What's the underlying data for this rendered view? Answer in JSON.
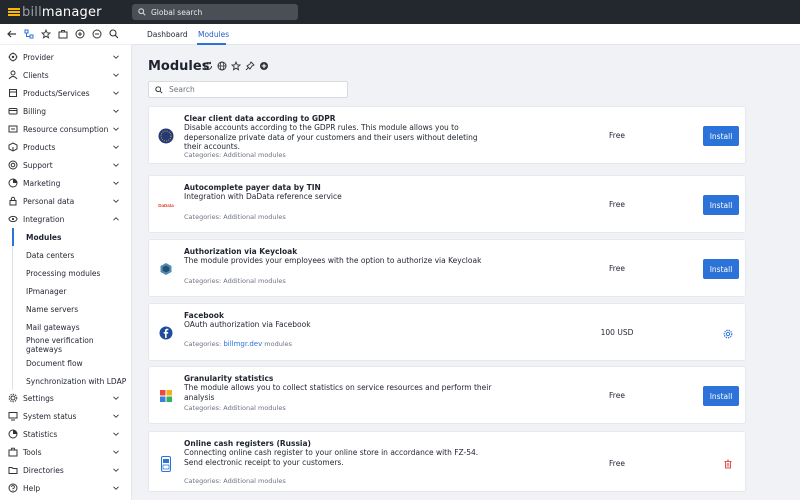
{
  "app": {
    "logo_prefix": "bill",
    "logo_suffix": "manager",
    "global_search_placeholder": "Global search"
  },
  "tabs": [
    {
      "label": "Dashboard"
    },
    {
      "label": "Modules",
      "active": true
    }
  ],
  "sidebar": {
    "items": [
      {
        "label": "Provider",
        "icon": "provider-icon"
      },
      {
        "label": "Clients",
        "icon": "clients-icon"
      },
      {
        "label": "Products/Services",
        "icon": "products-services-icon"
      },
      {
        "label": "Billing",
        "icon": "billing-icon"
      },
      {
        "label": "Resource consumption",
        "icon": "resource-icon"
      },
      {
        "label": "Products",
        "icon": "products-icon"
      },
      {
        "label": "Support",
        "icon": "support-icon"
      },
      {
        "label": "Marketing",
        "icon": "marketing-icon"
      },
      {
        "label": "Personal data",
        "icon": "personal-data-icon"
      },
      {
        "label": "Integration",
        "icon": "integration-icon",
        "expanded": true
      }
    ],
    "integration_sub": [
      {
        "label": "Modules",
        "active": true
      },
      {
        "label": "Data centers"
      },
      {
        "label": "Processing modules"
      },
      {
        "label": "IPmanager"
      },
      {
        "label": "Name servers"
      },
      {
        "label": "Mail gateways"
      },
      {
        "label": "Phone verification gateways"
      },
      {
        "label": "Document flow"
      },
      {
        "label": "Synchronization with LDAP"
      }
    ],
    "items_after": [
      {
        "label": "Settings",
        "icon": "settings-icon"
      },
      {
        "label": "System status",
        "icon": "system-status-icon"
      },
      {
        "label": "Statistics",
        "icon": "statistics-icon"
      },
      {
        "label": "Tools",
        "icon": "tools-icon"
      },
      {
        "label": "Directories",
        "icon": "directories-icon"
      },
      {
        "label": "Help",
        "icon": "help-icon"
      }
    ]
  },
  "main": {
    "title": "Modules",
    "search_placeholder": "Search",
    "cards": [
      {
        "title": "Clear client data according to GDPR",
        "desc": "Disable accounts according to the GDPR rules. This module allows you to depersonalize private data of your customers and their users without deleting their accounts.",
        "category_prefix": "Categories: Additional modules",
        "price": "Free",
        "action": "Install",
        "icon": "gdpr-icon"
      },
      {
        "title": "Autocomplete payer data by TIN",
        "desc": "Integration with DaData reference service",
        "category_prefix": "Categories: Additional modules",
        "price": "Free",
        "action": "Install",
        "icon": "dadata-icon"
      },
      {
        "title": "Authorization via Keycloak",
        "desc": "The module provides your employees with the option to authorize via Keycloak",
        "category_prefix": "Categories: Additional modules",
        "price": "Free",
        "action": "Install",
        "icon": "keycloak-icon"
      },
      {
        "title": "Facebook",
        "desc": "OAuth authorization via Facebook",
        "category_prefix": "Categories:",
        "category_link": "billmgr.dev",
        "category_suffix": "modules",
        "price": "100 USD",
        "action_icon": "settings-gear-icon",
        "icon": "facebook-icon"
      },
      {
        "title": "Granularity statistics",
        "desc": "The module allows you to collect statistics on service resources and perform their analysis",
        "category_prefix": "Categories: Additional modules",
        "price": "Free",
        "action": "Install",
        "icon": "granularity-icon"
      },
      {
        "title": "Online cash registers (Russia)",
        "desc": "Connecting online cash register to your online store in accordance with FZ-54. Send electronic receipt to your customers.",
        "category_prefix": "Categories: Additional modules",
        "price": "Free",
        "action_icon": "trash-icon",
        "icon": "cash-register-icon"
      }
    ]
  },
  "colors": {
    "topbar": "#23272e",
    "accent": "#2b73d8",
    "logo_yellow": "#f5b50c",
    "danger": "#e0554b"
  }
}
